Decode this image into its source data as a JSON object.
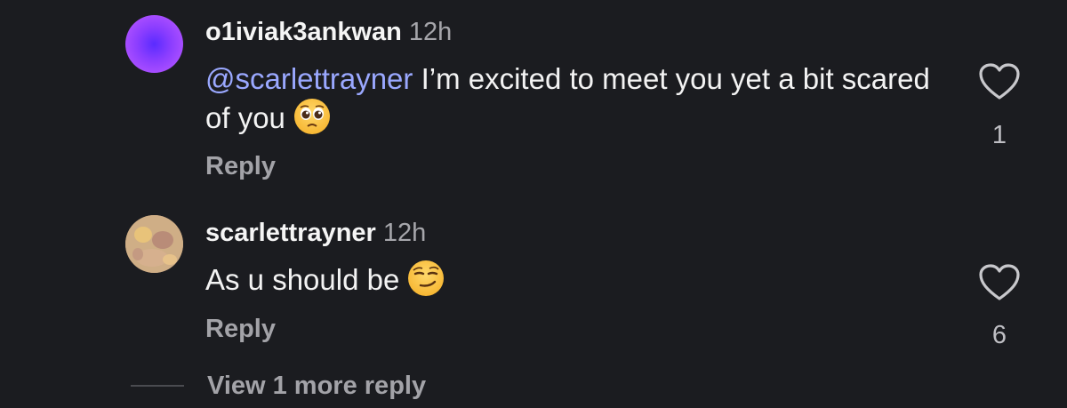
{
  "comments": [
    {
      "username": "o1iviak3ankwan",
      "time": "12h",
      "mention": "@scarlettrayner",
      "text": " I’m excited to meet you yet a bit scared of you",
      "reply_label": "Reply",
      "likes": "1",
      "emoji": "pleading-face-emoji",
      "avatar": "purple-gradient-avatar"
    },
    {
      "username": "scarlettrayner",
      "time": "12h",
      "mention": "",
      "text": "As u should be",
      "reply_label": "Reply",
      "likes": "6",
      "emoji": "smirking-face-emoji",
      "avatar": "photo-avatar"
    }
  ],
  "more_replies": {
    "label": "View 1 more reply"
  },
  "colors": {
    "background": "#1b1c20",
    "mention": "#9aa8ff",
    "secondary_text": "#a3a3a8"
  },
  "icons": {
    "like": "heart-outline-icon"
  }
}
